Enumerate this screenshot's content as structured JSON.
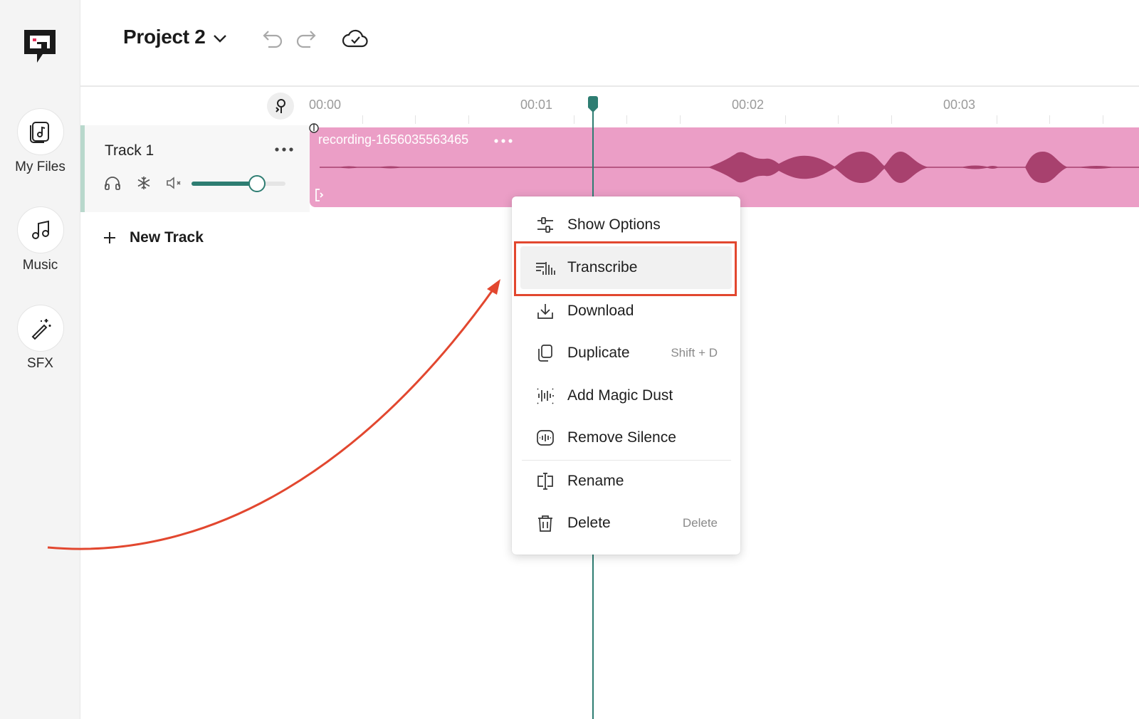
{
  "app": {
    "rail": {
      "items": [
        {
          "label": "My Files",
          "icon": "music-file-icon"
        },
        {
          "label": "Music",
          "icon": "music-note-icon"
        },
        {
          "label": "SFX",
          "icon": "magic-wand-icon"
        }
      ]
    },
    "topbar": {
      "project_title": "Project 2"
    },
    "timeline": {
      "ticks": [
        "00:00",
        "00:01",
        "00:02",
        "00:03"
      ]
    },
    "track": {
      "name": "Track 1",
      "volume_fraction": 0.7
    },
    "clip": {
      "name": "recording-1656035563465",
      "color": "#eb9ec6",
      "wave_color": "#a8416e"
    },
    "new_track_label": "New Track",
    "context_menu": {
      "items": [
        {
          "label": "Show Options",
          "icon": "sliders-icon",
          "shortcut": ""
        },
        {
          "label": "Transcribe",
          "icon": "transcribe-icon",
          "shortcut": "",
          "highlighted": true
        },
        {
          "label": "Download",
          "icon": "download-icon",
          "shortcut": ""
        },
        {
          "label": "Duplicate",
          "icon": "duplicate-icon",
          "shortcut": "Shift + D"
        },
        {
          "label": "Add Magic Dust",
          "icon": "magic-dust-icon",
          "shortcut": ""
        },
        {
          "label": "Remove Silence",
          "icon": "remove-silence-icon",
          "shortcut": ""
        },
        {
          "label": "Rename",
          "icon": "rename-icon",
          "shortcut": ""
        },
        {
          "label": "Delete",
          "icon": "trash-icon",
          "shortcut": "Delete"
        }
      ]
    },
    "colors": {
      "accent": "#2e7d72",
      "annotation": "#e2472f"
    }
  }
}
